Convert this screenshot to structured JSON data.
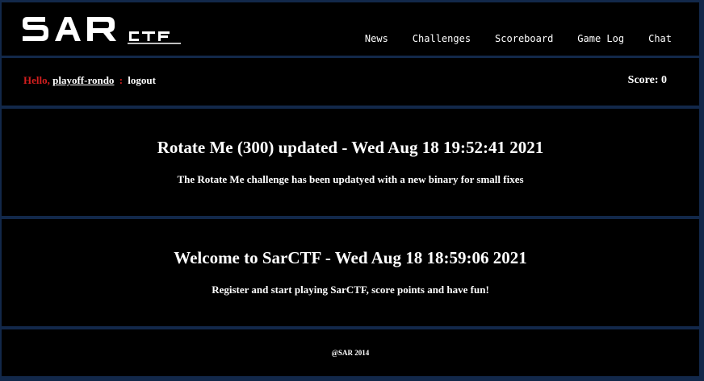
{
  "brand": {
    "logo_text": "SARCTF"
  },
  "nav": {
    "items": [
      {
        "label": "News"
      },
      {
        "label": "Challenges"
      },
      {
        "label": "Scoreboard"
      },
      {
        "label": "Game Log"
      },
      {
        "label": "Chat"
      }
    ]
  },
  "user": {
    "hello": "Hello,",
    "username": "playoff-rondo",
    "separator": ":",
    "logout": "logout",
    "score": "Score: 0"
  },
  "news": [
    {
      "title": "Rotate Me (300) updated - Wed Aug 18 19:52:41 2021",
      "body": "The Rotate Me challenge has been updatyed with a new binary for small fixes"
    },
    {
      "title": "Welcome to SarCTF - Wed Aug 18 18:59:06 2021",
      "body": "Register and start playing SarCTF, score points and have fun!"
    }
  ],
  "footer": {
    "text": "@SAR 2014"
  },
  "colors": {
    "background": "#12284a",
    "panel": "#000000",
    "accent": "#d21e1e"
  }
}
